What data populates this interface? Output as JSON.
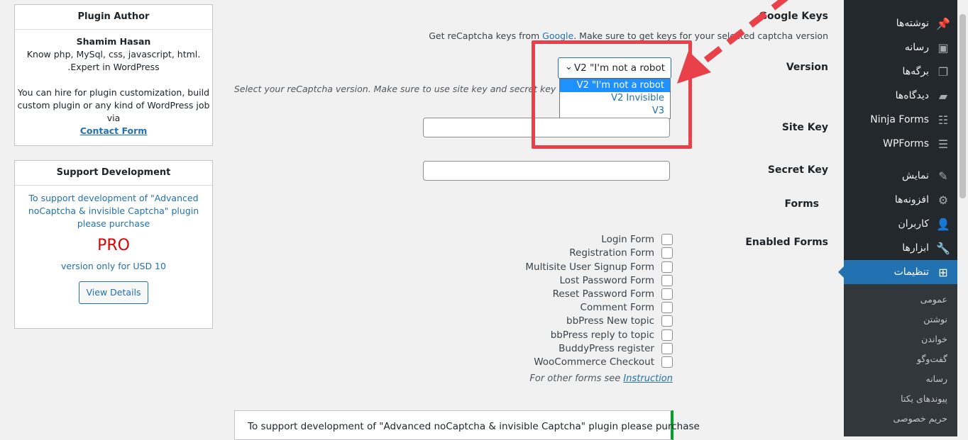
{
  "sidebar": {
    "items": [
      {
        "label": "نوشته‌ها",
        "icon": "pin-icon"
      },
      {
        "label": "رسانه",
        "icon": "media-icon"
      },
      {
        "label": "برگه‌ها",
        "icon": "pages-icon"
      },
      {
        "label": "دیدگاه‌ها",
        "icon": "comments-icon"
      },
      {
        "label": "Ninja Forms",
        "icon": "forms-icon"
      },
      {
        "label": "WPForms",
        "icon": "wpforms-icon"
      },
      {
        "label": "نمایش",
        "icon": "appearance-icon"
      },
      {
        "label": "افزونه‌ها",
        "icon": "plugins-icon"
      },
      {
        "label": "کاربران",
        "icon": "users-icon"
      },
      {
        "label": "ابزارها",
        "icon": "tools-icon"
      },
      {
        "label": "تنظیمات",
        "icon": "settings-icon"
      }
    ],
    "submenu": [
      "عمومی",
      "نوشتن",
      "خواندن",
      "گفت‌وگو",
      "رسانه",
      "پیوندهای یکتا",
      "حریم خصوصی"
    ]
  },
  "author_box": {
    "title": "Plugin Author",
    "name": "Shamim Hasan",
    "line1": "Know php, MySql, css, javascript, html.",
    "line2": ".Expert in WordPress",
    "line3": "You can hire for plugin customization, build",
    "line4": "custom plugin or any kind of WordPress job",
    "line5": "via",
    "contact": "Contact Form"
  },
  "support_box": {
    "title": "Support Development",
    "line1": "To support development of \"Advanced",
    "line2": "noCaptcha & invisible Captcha\" plugin",
    "line3": "please purchase",
    "pro": "PRO",
    "line4": "version only for USD 10",
    "button": "View Details"
  },
  "form": {
    "heading": "Google Keys",
    "help_prefix": "Get reCaptcha keys from ",
    "help_link": "Google",
    "help_suffix": ". Make sure to get keys for your selected captcha version",
    "version_label": "Version",
    "version_selected": "V2 \"I'm not a robot",
    "version_options": [
      "V2 \"I'm not a robot",
      "V2 Invisible",
      "V3"
    ],
    "version_help": "Select your reCaptcha version. Make sure to use site key and secret key for your selected version.",
    "site_key_label": "Site Key",
    "site_key_value": "",
    "secret_key_label": "Secret Key",
    "secret_key_value": "",
    "forms_label": "Forms",
    "enabled_forms_label": "Enabled Forms",
    "checkboxes": [
      "Login Form",
      "Registration Form",
      "Multisite User Signup Form",
      "Lost Password Form",
      "Reset Password Form",
      "Comment Form",
      "bbPress New topic",
      "bbPress reply to topic",
      "BuddyPress register",
      "WooCommerce Checkout"
    ],
    "other_forms_prefix": "For other forms see ",
    "other_forms_link": "Instruction",
    "bottom_notice": "To support development of \"Advanced noCaptcha & invisible Captcha\" plugin please purchase"
  },
  "colors": {
    "annotation": "#e8414a",
    "accent": "#2271b1",
    "pro": "#e00000"
  }
}
